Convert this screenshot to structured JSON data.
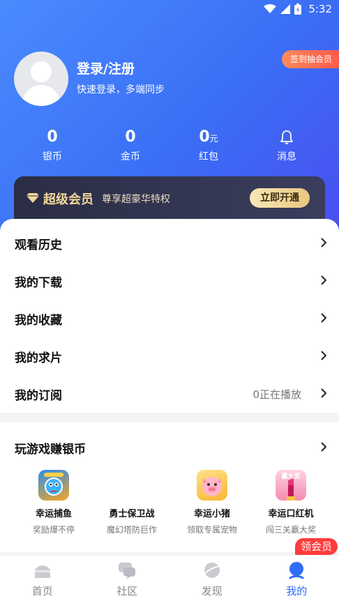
{
  "status_bar": {
    "time": "5:32"
  },
  "profile": {
    "login_title": "登录/注册",
    "login_subtitle": "快速登录，多端同步",
    "checkin_label": "签到抽会员"
  },
  "stats": [
    {
      "value": "0",
      "unit": "",
      "label": "银币"
    },
    {
      "value": "0",
      "unit": "",
      "label": "金币"
    },
    {
      "value": "0",
      "unit": "元",
      "label": "红包"
    },
    {
      "icon": "bell-icon",
      "label": "消息"
    }
  ],
  "vip": {
    "title": "超级会员",
    "subtitle": "尊享超豪华特权",
    "button": "立即开通",
    "accent": "#f3d79b"
  },
  "menu": [
    {
      "label": "观看历史",
      "value": ""
    },
    {
      "label": "我的下载",
      "value": ""
    },
    {
      "label": "我的收藏",
      "value": ""
    },
    {
      "label": "我的求片",
      "value": ""
    },
    {
      "label": "我的订阅",
      "value": "0正在播放"
    }
  ],
  "games": {
    "title": "玩游戏赚银币",
    "items": [
      {
        "name": "幸运捕鱼",
        "desc": "奖励爆不停"
      },
      {
        "name": "勇士保卫战",
        "desc": "魔幻塔防巨作"
      },
      {
        "name": "幸运小猪",
        "desc": "领取专属宠物"
      },
      {
        "name": "幸运口红机",
        "desc": "闯三关赢大奖",
        "badge": "赢大奖"
      }
    ]
  },
  "member_tag": "领会员",
  "nav": [
    {
      "label": "首页",
      "icon": "home-icon",
      "active": false
    },
    {
      "label": "社区",
      "icon": "community-icon",
      "active": false
    },
    {
      "label": "发现",
      "icon": "discover-icon",
      "active": false
    },
    {
      "label": "我的",
      "icon": "profile-icon",
      "active": true
    }
  ],
  "colors": {
    "primary": "#2f6df4",
    "header_start": "#4a8bff",
    "header_end": "#4a4ef0",
    "tag_red": "#ff3b3b"
  }
}
